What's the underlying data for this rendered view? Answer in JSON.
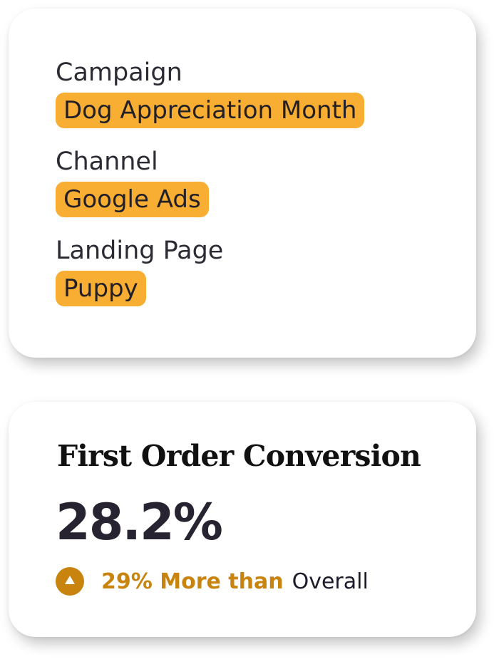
{
  "attributes": {
    "campaign": {
      "label": "Campaign",
      "value": "Dog Appreciation Month"
    },
    "channel": {
      "label": "Channel",
      "value": "Google Ads"
    },
    "landing_page": {
      "label": "Landing Page",
      "value": "Puppy"
    }
  },
  "metric": {
    "title": "First Order Conversion",
    "value": "28.2%",
    "comparison": {
      "delta_text": "29% More than",
      "baseline_text": "Overall",
      "direction": "up",
      "icon": "arrow-up-circle-icon"
    }
  },
  "colors": {
    "tag_background": "#f8ae32",
    "accent": "#c9840f",
    "text_dark": "#272331",
    "card_background": "#ffffff"
  }
}
